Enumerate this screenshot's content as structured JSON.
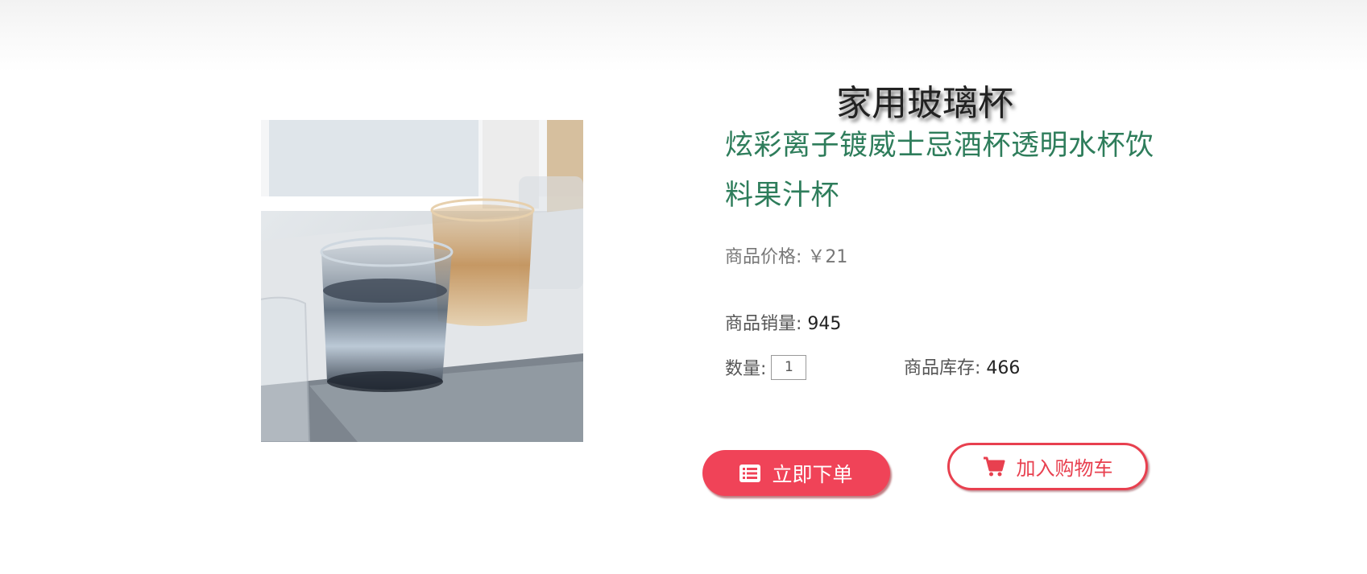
{
  "product": {
    "name": "家用玻璃杯",
    "description": "炫彩离子镀威士忌酒杯透明水杯饮料果汁杯",
    "price_label": "商品价格:",
    "price_value": "￥21",
    "sales_label": "商品销量:",
    "sales_value": "945",
    "quantity_label": "数量:",
    "quantity_value": "1",
    "stock_label": "商品库存:",
    "stock_value": "466"
  },
  "actions": {
    "order_now": "立即下单",
    "order_icon": "list-icon",
    "add_to_cart": "加入购物车",
    "cart_icon": "shopping-cart-icon"
  },
  "colors": {
    "accent": "#f04358",
    "description": "#2e7d5b"
  }
}
